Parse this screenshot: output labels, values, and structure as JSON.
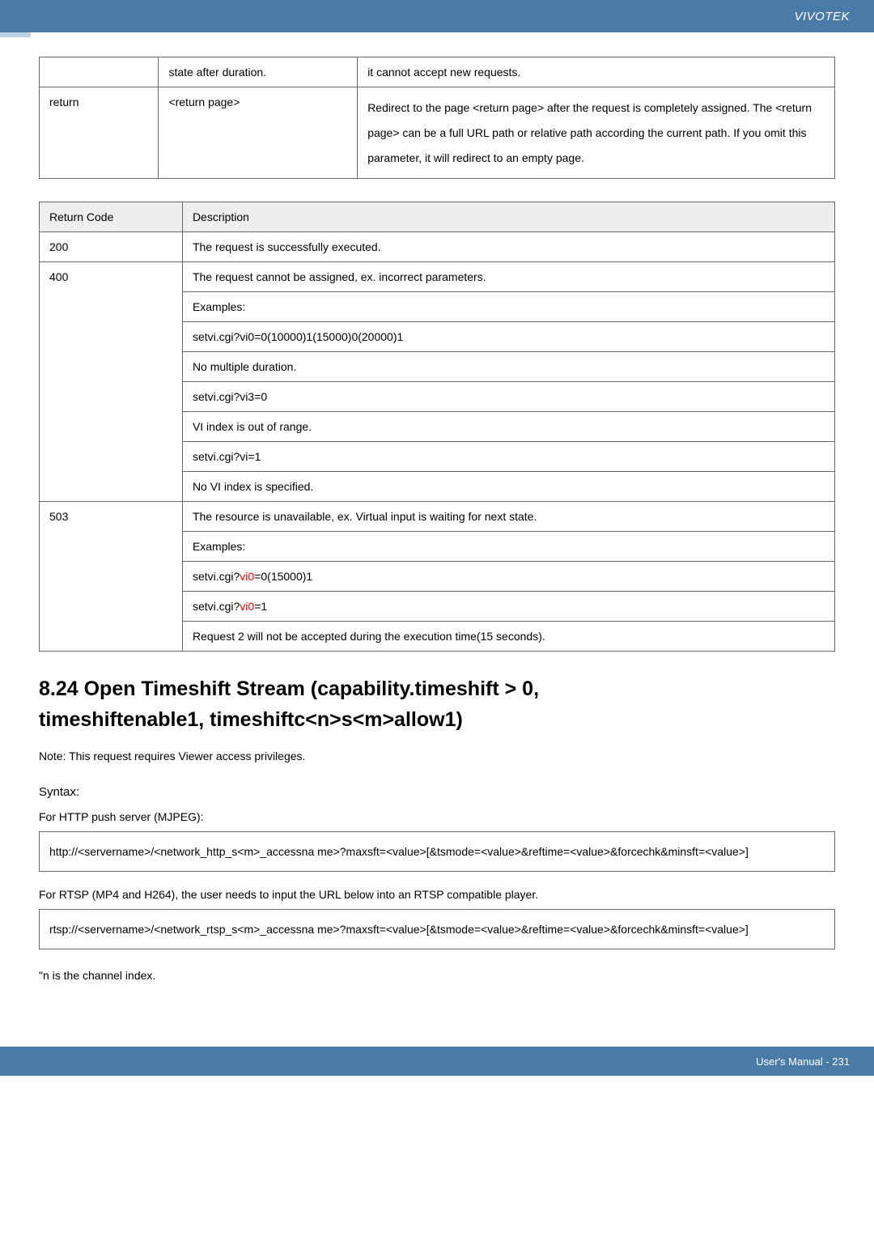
{
  "header": {
    "brand": "VIVOTEK"
  },
  "table1": {
    "r1c2": "state after duration.",
    "r1c3": "it cannot accept new requests.",
    "r2c1": "return",
    "r2c2": "<return page>",
    "r2c3": "Redirect to the page <return page> after the request is completely assigned. The <return page> can be a full URL path or relative path according the current path. If you omit this parameter, it will redirect to an empty page."
  },
  "table2": {
    "h1": "Return Code",
    "h2": "Description",
    "r200": "200",
    "r200d": "The request is successfully executed.",
    "r400": "400",
    "r400a": "The request cannot be assigned, ex. incorrect parameters.",
    "r400b": "Examples:",
    "r400c": "setvi.cgi?vi0=0(10000)1(15000)0(20000)1",
    "r400d": "No multiple duration.",
    "r400e": "setvi.cgi?vi3=0",
    "r400f": "VI index is out of range.",
    "r400g": "setvi.cgi?vi=1",
    "r400h": "No VI index is specified.",
    "r503": "503",
    "r503a": "The resource is unavailable, ex. Virtual input is waiting for next state.",
    "r503b": "Examples:",
    "r503c_pre": "setvi.cgi?",
    "r503c_red": "vi0",
    "r503c_post": "=0(15000)1",
    "r503d_pre": "setvi.cgi?",
    "r503d_red": "vi0",
    "r503d_post": "=1",
    "r503e": "Request 2 will not be accepted during the execution time(15 seconds)."
  },
  "heading": {
    "line1": "8.24 Open Timeshift Stream (capability.timeshift > 0,",
    "line2": "timeshiftenable1, timeshiftc<n>s<m>allow1)"
  },
  "note": "Note:   This request requires Viewer access privileges.",
  "syntax": "Syntax:",
  "mjpeg_label": "For HTTP push server (MJPEG):",
  "http_box": "http://<servername>/<network_http_s<m>_accessna me>?maxsft=<value>[&tsmode=<value>&reftime=<value>&forcechk&minsft=<value>]",
  "rtsp_label": "For RTSP (MP4 and H264), the user needs to input the URL below into an RTSP compatible player.",
  "rtsp_box": "rtsp://<servername>/<network_rtsp_s<m>_accessna me>?maxsft=<value>[&tsmode=<value>&reftime=<value>&forcechk&minsft=<value>]",
  "footnote": "\"n is the channel index.",
  "footer": "User's Manual - 231"
}
